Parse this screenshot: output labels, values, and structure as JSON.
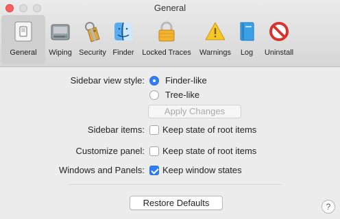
{
  "window": {
    "title": "General"
  },
  "toolbar": {
    "items": [
      {
        "label": "General",
        "icon": "general-switch-icon",
        "selected": true
      },
      {
        "label": "Wiping",
        "icon": "hard-drive-icon",
        "selected": false
      },
      {
        "label": "Security",
        "icon": "keychain-icon",
        "selected": false
      },
      {
        "label": "Finder",
        "icon": "finder-icon",
        "selected": false
      },
      {
        "label": "Locked Traces",
        "icon": "padlock-icon",
        "selected": false
      },
      {
        "label": "Warnings",
        "icon": "warning-icon",
        "selected": false
      },
      {
        "label": "Log",
        "icon": "log-book-icon",
        "selected": false
      },
      {
        "label": "Uninstall",
        "icon": "prohibited-icon",
        "selected": false
      }
    ]
  },
  "settings": {
    "sidebar_view_style": {
      "label": "Sidebar view style:",
      "options": [
        {
          "label": "Finder-like",
          "selected": true
        },
        {
          "label": "Tree-like",
          "selected": false
        }
      ],
      "apply_button": "Apply Changes"
    },
    "sidebar_items": {
      "label": "Sidebar items:",
      "checkbox": "Keep state of root items",
      "checked": false
    },
    "customize_panel": {
      "label": "Customize panel:",
      "checkbox": "Keep state of root items",
      "checked": false
    },
    "windows_and_panels": {
      "label": "Windows and Panels:",
      "checkbox": "Keep window states",
      "checked": true
    },
    "restore_button": "Restore  Defaults",
    "help_button": "?"
  },
  "colors": {
    "accent": "#2f7ef6",
    "close_button": "#fc605c"
  }
}
